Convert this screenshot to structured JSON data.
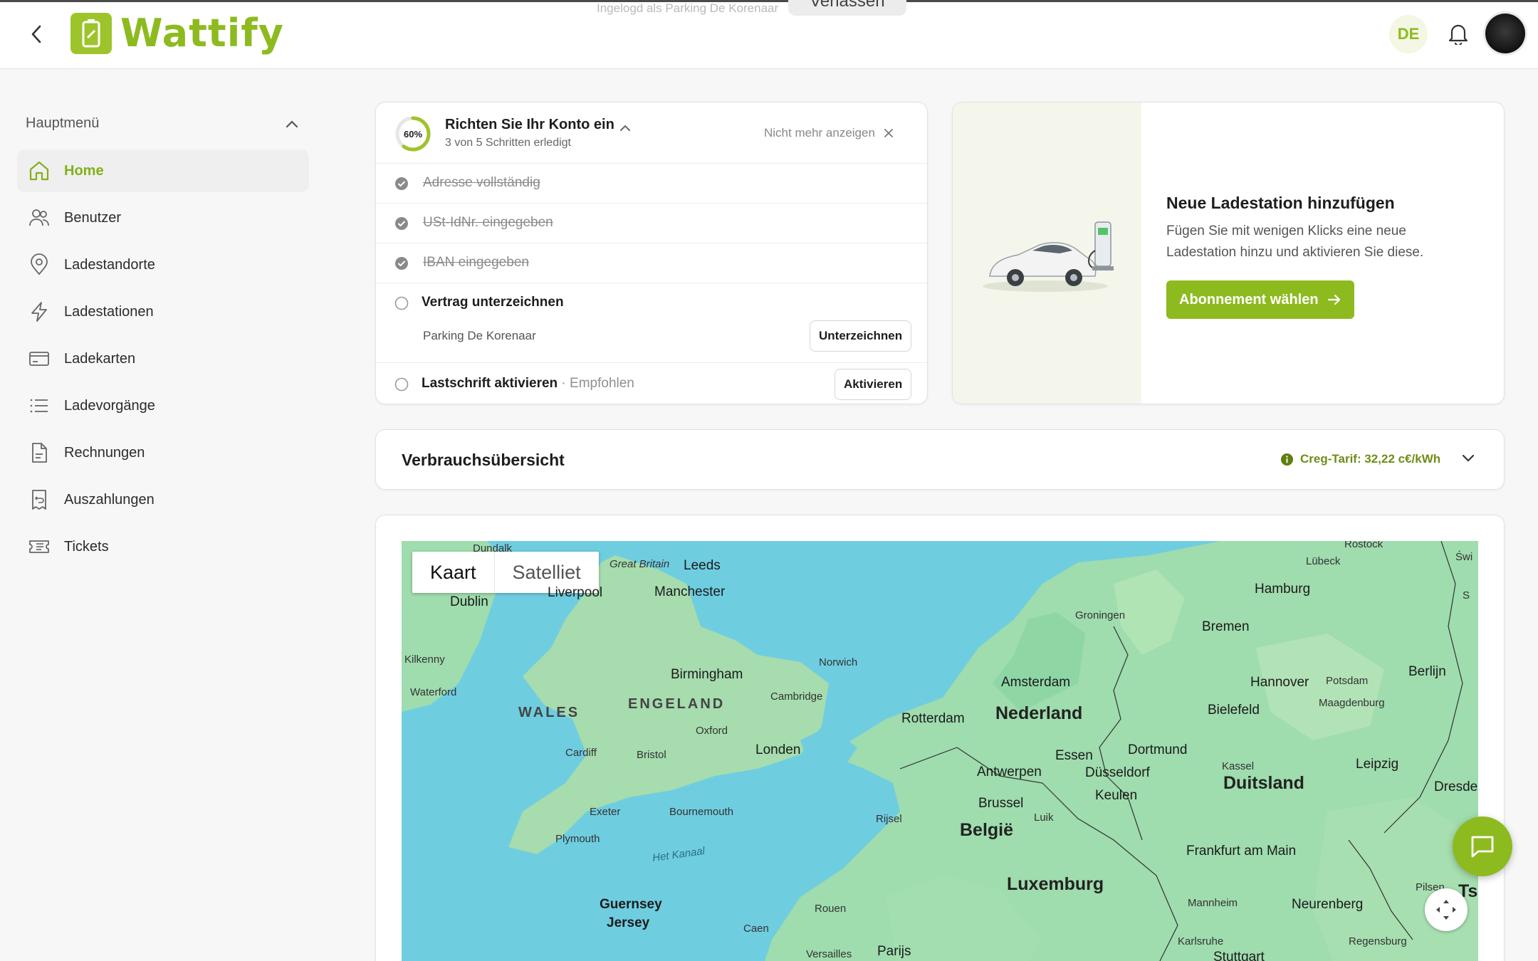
{
  "header": {
    "brand": "Wattify",
    "impersonation_text": "Ingelogd als Parking De Korenaar",
    "leave_label": "Verlassen",
    "language": "DE",
    "icons": [
      "chevron-left-icon",
      "bell-icon",
      "avatar"
    ]
  },
  "sidebar": {
    "section_title": "Hauptmenü",
    "items": [
      {
        "label": "Home",
        "icon": "home-icon",
        "active": true
      },
      {
        "label": "Benutzer",
        "icon": "users-icon"
      },
      {
        "label": "Ladestandorte",
        "icon": "location-pin-icon"
      },
      {
        "label": "Ladestationen",
        "icon": "lightning-icon"
      },
      {
        "label": "Ladekarten",
        "icon": "credit-card-icon"
      },
      {
        "label": "Ladevorgänge",
        "icon": "list-icon"
      },
      {
        "label": "Rechnungen",
        "icon": "document-icon"
      },
      {
        "label": "Auszahlungen",
        "icon": "receipt-icon"
      },
      {
        "label": "Tickets",
        "icon": "ticket-icon"
      }
    ]
  },
  "setup": {
    "progress_label": "60%",
    "progress_fraction": 0.6,
    "title": "Richten Sie Ihr Konto ein",
    "subtitle": "3 von 5 Schritten erledigt",
    "dismiss_label": "Nicht mehr anzeigen",
    "tasks": [
      {
        "label": "Adresse vollständig",
        "done": true
      },
      {
        "label": "USt-IdNr. eingegeben",
        "done": true
      },
      {
        "label": "IBAN eingegeben",
        "done": true
      },
      {
        "label": "Vertrag unterzeichnen",
        "done": false,
        "detail": "Parking De Korenaar",
        "action": "Unterzeichnen"
      },
      {
        "label": "Lastschrift aktivieren",
        "done": false,
        "tag": "· Empfohlen",
        "action": "Aktivieren"
      }
    ]
  },
  "promo": {
    "title": "Neue Ladestation hinzufügen",
    "description": "Fügen Sie mit wenigen Klicks eine neue Ladestation hinzu und aktivieren Sie diese.",
    "button_label": "Abonnement wählen"
  },
  "usage": {
    "title": "Verbrauchsübersicht",
    "tariff": "Creg-Tarif: 32,22 c€/kWh"
  },
  "map": {
    "tabs": [
      "Kaart",
      "Satelliet"
    ],
    "active_tab": "Kaart",
    "labels": {
      "dundalk": "Dundalk",
      "dublin": "Dublin",
      "kilkenny": "Kilkenny",
      "waterford": "Waterford",
      "great_britain": "Great Britain",
      "leeds": "Leeds",
      "liverpool": "Liverpool",
      "manchester": "Manchester",
      "birmingham": "Birmingham",
      "norwich": "Norwich",
      "wales": "WALES",
      "engeland": "ENGELAND",
      "cambridge": "Cambridge",
      "oxford": "Oxford",
      "cardiff": "Cardiff",
      "bristol": "Bristol",
      "londen": "Londen",
      "exeter": "Exeter",
      "bournemouth": "Bournemouth",
      "plymouth": "Plymouth",
      "het_kanaal": "Het Kanaal",
      "guernsey": "Guernsey",
      "jersey": "Jersey",
      "caen": "Caen",
      "rouen": "Rouen",
      "versailles": "Versailles",
      "parijs": "Parijs",
      "groningen": "Groningen",
      "amsterdam": "Amsterdam",
      "nederland": "Nederland",
      "rotterdam": "Rotterdam",
      "essen": "Essen",
      "dortmund": "Dortmund",
      "antwerpen": "Antwerpen",
      "dusseldorf": "Düsseldorf",
      "brussel": "Brussel",
      "keulen": "Keulen",
      "rijsel": "Rijsel",
      "luik": "Luik",
      "belgie": "België",
      "luxemburg": "Luxemburg",
      "frankfurt": "Frankfurt am Main",
      "mannheim": "Mannheim",
      "karlsruhe": "Karlsruhe",
      "stuttgart": "Stuttgart",
      "rostock": "Rostock",
      "lubeck": "Lübeck",
      "hamburg": "Hamburg",
      "bremen": "Bremen",
      "hannover": "Hannover",
      "bielefeld": "Bielefeld",
      "kassel": "Kassel",
      "duitsland": "Duitsland",
      "leipzig": "Leipzig",
      "dresden": "Dresden",
      "berlijn": "Berlijn",
      "potsdam": "Potsdam",
      "maagdenburg": "Maagdenburg",
      "pilsen": "Pilsen",
      "neurenberg": "Neurenberg",
      "regensburg": "Regensburg",
      "swinoujscie": "Świ",
      "szczecin": "S",
      "ts": "Ts"
    }
  },
  "colors": {
    "brand": "#8dbb1f",
    "water": "#6fcde0",
    "land": "#9fdcae"
  }
}
